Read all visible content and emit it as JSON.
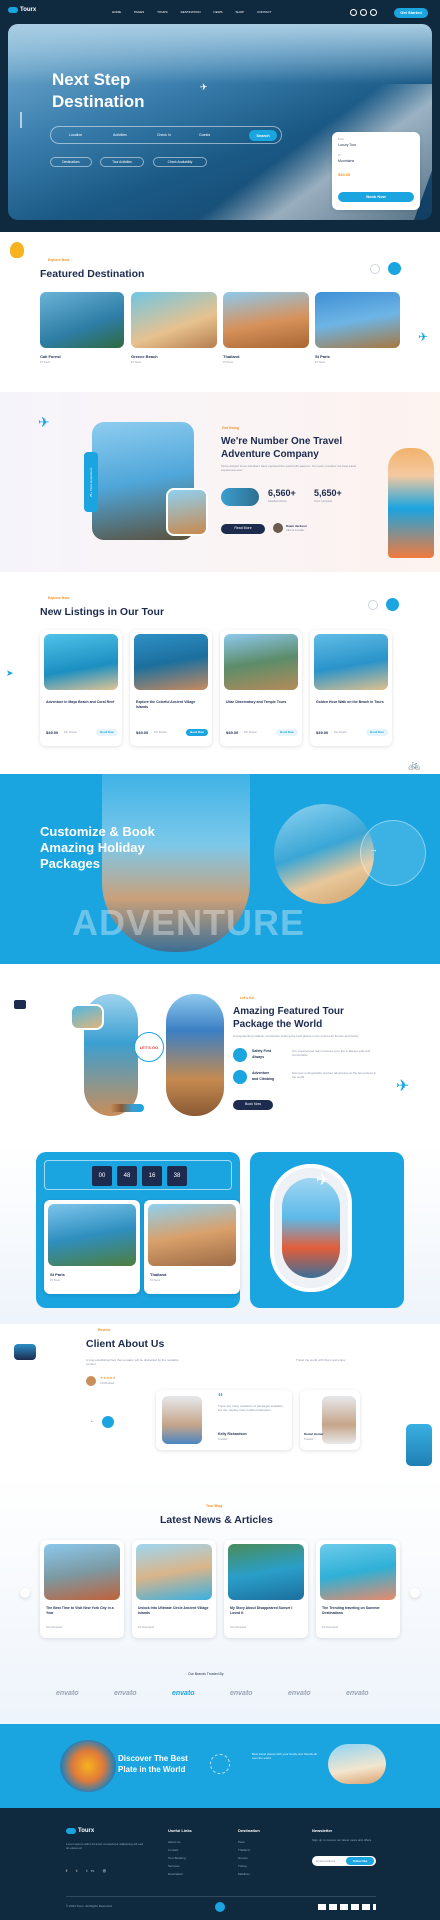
{
  "header": {
    "logo": "Tourx",
    "nav": [
      "HOME",
      "PAGES",
      "TOURS",
      "DESTINATION",
      "NEWS",
      "SHOP",
      "CONTACT"
    ],
    "cta": "Get Started"
  },
  "hero": {
    "title_line1": "Next Step",
    "title_line2": "Destination",
    "fields": [
      "Location",
      "Activities",
      "Check In",
      "Guests"
    ],
    "search": "Search",
    "filters": [
      "Destinations",
      "Tour Activities",
      "Check Availability"
    ],
    "booking_label": "From",
    "booking_value": "Luxury Tour",
    "booking_label2": "To",
    "booking_value2": "Mountains",
    "price": "$49.00",
    "booking_cta": "Book Now"
  },
  "featured": {
    "subtitle": "Explore Now",
    "title": "Featured Destination",
    "items": [
      {
        "name": "Cali Forest",
        "meta": "15 Tours"
      },
      {
        "name": "Greece Beach",
        "meta": "15 Tours"
      },
      {
        "name": "Thailand",
        "meta": "15 Tours"
      },
      {
        "name": "St Paris",
        "meta": "15 Tours"
      }
    ]
  },
  "about": {
    "subtitle": "Get Going",
    "title_line1": "We're Number One Travel",
    "title_line2": "Adventure Company",
    "desc": "Since ancient times travellers have explored the world with passion. Our team provides the best travel experience ever.",
    "stat1_value": "6,560+",
    "stat1_label": "Satisfied Clients",
    "stat2_value": "5,650+",
    "stat2_label": "Tours Complete",
    "cta": "Read More",
    "ceo_name": "Dawn Jackson",
    "ceo_role": "CEO & Founder",
    "badge": "25+ Years Experience"
  },
  "listings": {
    "subtitle": "Explore Now",
    "title": "New Listings in Our Tour",
    "items": [
      {
        "title": "Adventure in Maya Beach and Coral Reef",
        "price": "$49.00",
        "meta": "Per Person",
        "cta": "Book Now"
      },
      {
        "title": "Explore the Colorful Ancient Village Islands",
        "price": "$49.00",
        "meta": "Per Person",
        "cta": "Book Now"
      },
      {
        "title": "Ultar Observatory and Temple Tours",
        "price": "$49.00",
        "meta": "Per Person",
        "cta": "Book Now"
      },
      {
        "title": "Golden Hour Walk on the Beach in Tours",
        "price": "$49.00",
        "meta": "Per Person",
        "cta": "Book Now"
      }
    ]
  },
  "customize": {
    "title_line1": "Customize & Book",
    "title_line2": "Amazing Holiday",
    "title_line3": "Packages",
    "watermark": "ADVENTURE"
  },
  "package": {
    "subtitle": "Let's Go",
    "title_line1": "Amazing Featured Tour",
    "title_line2": "Package the World",
    "desc": "A longstanding tradition of travelers sharing the best places in the world with friends and family.",
    "features": [
      {
        "title": "Safety First",
        "title2": "Always",
        "desc": "Our experienced team ensures your trip is always safe and comfortable."
      },
      {
        "title": "Adventure",
        "title2": "and Climbing",
        "desc": "Discover unforgettable outdoor adventures at the best places in the world."
      }
    ],
    "cta": "Book Now",
    "badge": "LET'S GO"
  },
  "countdown": {
    "values": [
      "00",
      "48",
      "16",
      "38"
    ],
    "cards": [
      {
        "name": "St Paris",
        "meta": "15 Tours"
      },
      {
        "name": "Thailand",
        "meta": "15 Tours"
      }
    ]
  },
  "testimonials": {
    "subtitle": "Review",
    "title": "Client About Us",
    "desc": "A long established fact that a reader will be distracted by the readable content.",
    "rating": "★★★★★",
    "rating_label": "4.9 Reviews",
    "quote": "There are many variations of passages available, but the majority have suffered alteration.",
    "name": "Kelly Richardson",
    "role": "Traveler",
    "name2": "Daniel Hunter",
    "role2": "Traveler",
    "side_text": "Travel the world with Tourx and enjoy."
  },
  "news": {
    "subtitle": "Tour Blog",
    "title": "Latest News & Articles",
    "items": [
      {
        "title": "The Best Time to Visit New York City in a Year"
      },
      {
        "title": "Unlock Into Ultimate Circle Ancient Village Islands"
      },
      {
        "title": "My Story About Disappeared Sunset I Loved It"
      },
      {
        "title": "The Trending traveling on Summer Destinations"
      }
    ],
    "meta": "15 Comments"
  },
  "brands": {
    "title": "Our Brands Trusted By",
    "names": [
      "envato",
      "envato",
      "envato",
      "envato",
      "envato",
      "envato"
    ]
  },
  "banner": {
    "title_line1": "Discover The Best",
    "title_line2": "Plate in the World",
    "desc": "Best travel places with your family and friends all over the world."
  },
  "footer": {
    "logo": "Tourx",
    "desc": "Lorem ipsum dolor sit amet consectetur adipiscing elit sed do eiusmod.",
    "col1_title": "Useful Links",
    "col1": [
      "About Us",
      "Contact",
      "Tour Booking",
      "Services",
      "Destination"
    ],
    "col2_title": "Destination",
    "col2": [
      "Paris",
      "Thailand",
      "Greece",
      "Turkey",
      "Maldives"
    ],
    "col3_title": "Newsletter",
    "col3_desc": "Sign up to receive our latest news and offers.",
    "email_placeholder": "Email Address",
    "subscribe": "Subscribe",
    "copyright": "© 2024 Tourx. All Rights Reserved."
  },
  "colors": {
    "accent": "#1aa4e0",
    "navy": "#1d2b4f",
    "orange": "#f7921e",
    "footer_bg": "#0f2a3f"
  }
}
